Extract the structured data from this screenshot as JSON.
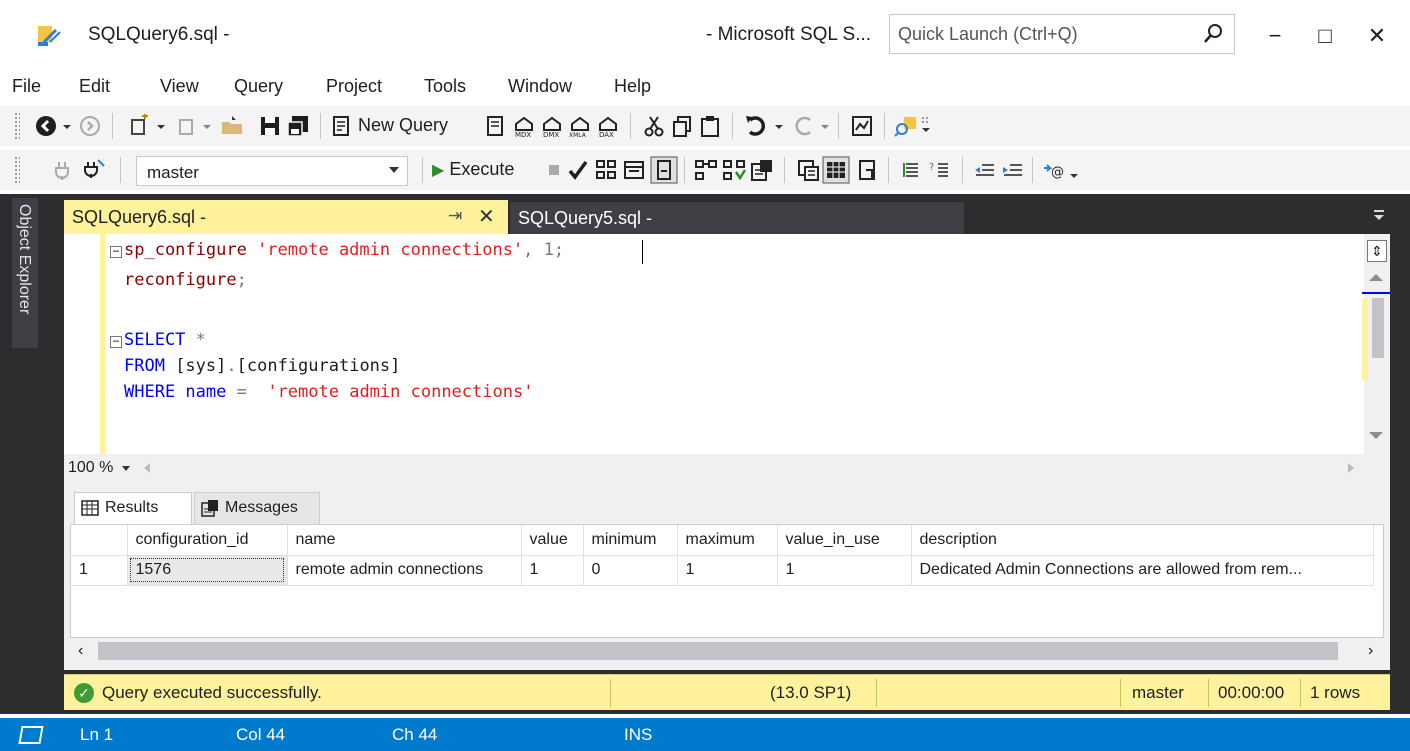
{
  "window": {
    "doc_title": "SQLQuery6.sql -",
    "app_title": "- Microsoft SQL S...",
    "quick_launch_placeholder": "Quick Launch (Ctrl+Q)",
    "minimize": "−",
    "maximize": "□",
    "close": "✕"
  },
  "menu": [
    "File",
    "Edit",
    "View",
    "Query",
    "Project",
    "Tools",
    "Window",
    "Help"
  ],
  "toolbar1": {
    "new_query_label": "New Query"
  },
  "toolbar2": {
    "database": "master",
    "execute_label": "Execute"
  },
  "side": {
    "object_explorer": "Object Explorer"
  },
  "tabs": {
    "active": "SQLQuery6.sql -",
    "pin": "⇥",
    "close": "✕",
    "inactive": "SQLQuery5.sql -"
  },
  "editor": {
    "lines": [
      {
        "k": "sp_configure ",
        "s": "'remote admin connections'",
        "t": ", 1;"
      },
      {
        "k": "reconfigure",
        "t": ";"
      },
      {
        "k": "SELECT ",
        "g": "*"
      },
      {
        "k": "FROM ",
        "t": "[sys]",
        "g": ".",
        "t2": "[configurations]"
      },
      {
        "k": "WHERE ",
        "t": "name ",
        "g": "= ",
        "s": " 'remote admin connections'"
      }
    ],
    "zoom": "100 %"
  },
  "results": {
    "tab_results": "Results",
    "tab_messages": "Messages",
    "columns": [
      "configuration_id",
      "name",
      "value",
      "minimum",
      "maximum",
      "value_in_use",
      "description"
    ],
    "rows": [
      {
        "num": "1",
        "cells": [
          "1576",
          "remote admin connections",
          "1",
          "0",
          "1",
          "1",
          "Dedicated Admin Connections are allowed from rem..."
        ]
      }
    ]
  },
  "query_status": {
    "message": "Query executed successfully.",
    "version": "(13.0 SP1)",
    "database": "master",
    "elapsed": "00:00:00",
    "rows": "1 rows"
  },
  "statusbar": {
    "ln": "Ln 1",
    "col": "Col 44",
    "ch": "Ch 44",
    "mode": "INS"
  },
  "colors": {
    "status_blue": "#007acc",
    "doc_yellow": "#fff29d",
    "frame_dark": "#2d2d30",
    "keyword_blue": "#0000ff",
    "string_red": "#e01f1f"
  }
}
